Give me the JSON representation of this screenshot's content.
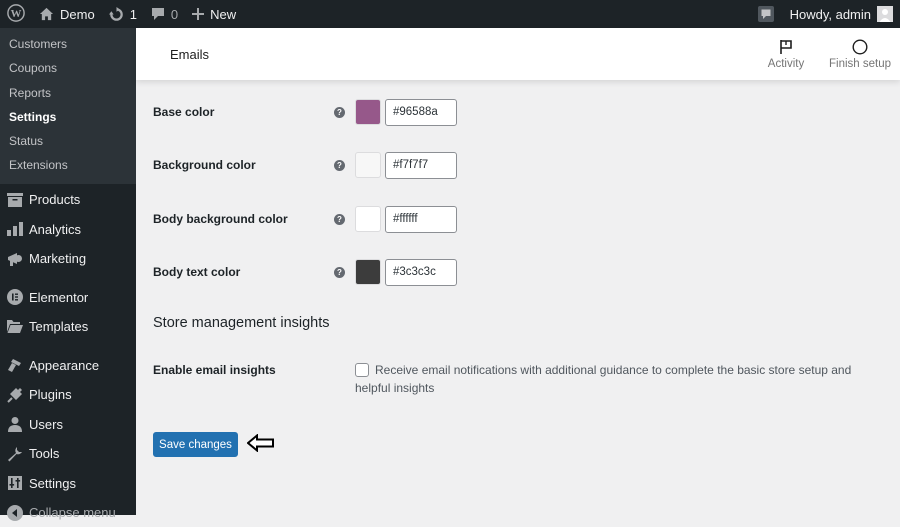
{
  "adminbar": {
    "site_name": "Demo",
    "updates_count": "1",
    "comments_count": "0",
    "new_label": "New",
    "greeting": "Howdy, admin"
  },
  "sidebar": {
    "submenu": [
      {
        "label": "Customers",
        "current": false
      },
      {
        "label": "Coupons",
        "current": false
      },
      {
        "label": "Reports",
        "current": false
      },
      {
        "label": "Settings",
        "current": true
      },
      {
        "label": "Status",
        "current": false
      },
      {
        "label": "Extensions",
        "current": false
      }
    ],
    "menu": [
      {
        "label": "Products",
        "icon": "archive-icon"
      },
      {
        "label": "Analytics",
        "icon": "bar-chart-icon"
      },
      {
        "label": "Marketing",
        "icon": "megaphone-icon"
      },
      {
        "label": "Elementor",
        "icon": "elementor-icon"
      },
      {
        "label": "Templates",
        "icon": "folder-open-icon"
      },
      {
        "label": "Appearance",
        "icon": "paintbrush-icon"
      },
      {
        "label": "Plugins",
        "icon": "plug-icon"
      },
      {
        "label": "Users",
        "icon": "user-icon"
      },
      {
        "label": "Tools",
        "icon": "wrench-icon"
      },
      {
        "label": "Settings",
        "icon": "sliders-icon"
      },
      {
        "label": "Collapse menu",
        "icon": "collapse-icon"
      }
    ]
  },
  "header": {
    "title": "Emails",
    "activity_label": "Activity",
    "finish_setup_label": "Finish setup"
  },
  "colors": [
    {
      "label": "Base color",
      "value": "#96588a",
      "swatch": "#96588a"
    },
    {
      "label": "Background color",
      "value": "#f7f7f7",
      "swatch": "#f7f7f7"
    },
    {
      "label": "Body background color",
      "value": "#ffffff",
      "swatch": "#ffffff"
    },
    {
      "label": "Body text color",
      "value": "#3c3c3c",
      "swatch": "#3c3c3c"
    }
  ],
  "insights": {
    "section_title": "Store management insights",
    "label": "Enable email insights",
    "checkbox_text": "Receive email notifications with additional guidance to complete the basic store setup and helpful insights",
    "checked": false
  },
  "save_label": "Save changes",
  "accent_color": "#2271b1"
}
